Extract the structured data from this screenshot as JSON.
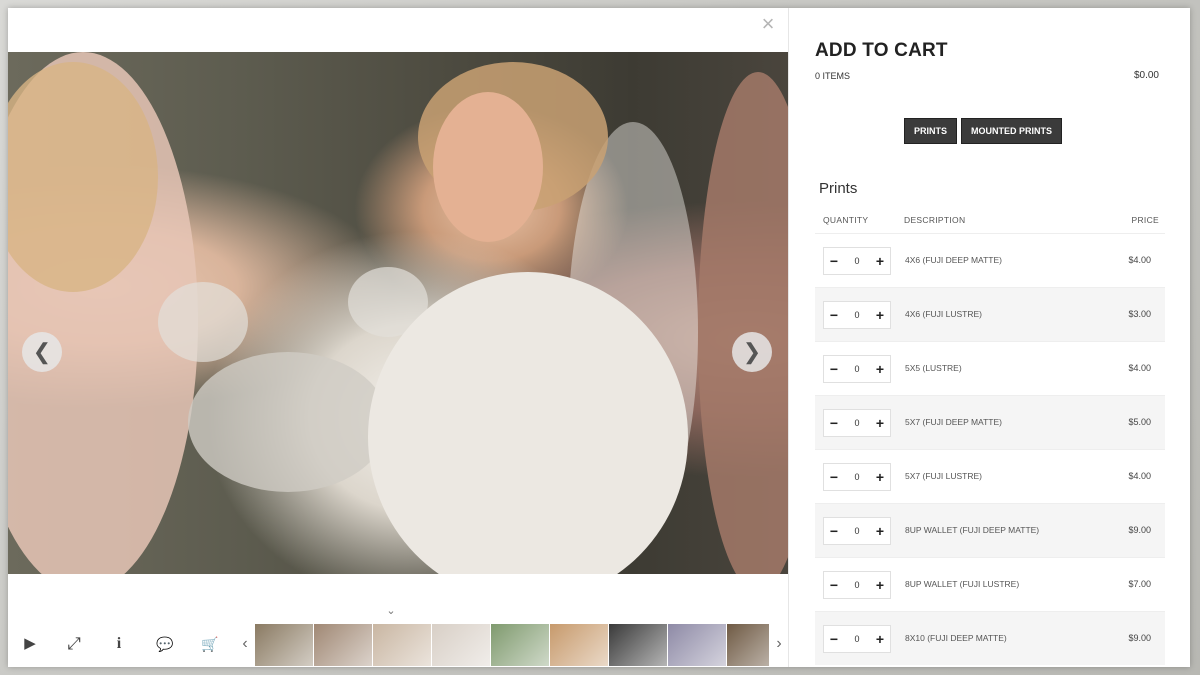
{
  "viewer": {
    "close_glyph": "×",
    "prev_glyph": "❮",
    "next_glyph": "❯",
    "collapse_glyph": "⌄",
    "toolbar": {
      "play_icon": "▶",
      "fullscreen_icon": "⤢",
      "info_icon": "i",
      "comment_icon": "💬",
      "cart_icon": "🛒"
    },
    "thumb_prev_glyph": "‹",
    "thumb_next_glyph": "›",
    "thumbnails": [
      {
        "color": "#8a7a62"
      },
      {
        "color": "#a08874"
      },
      {
        "color": "#c9b6a2"
      },
      {
        "color": "#d8cfc6"
      },
      {
        "color": "#7f9a6e"
      },
      {
        "color": "#c79a6c"
      },
      {
        "color": "#3a3a3a"
      },
      {
        "color": "#8e8aa6"
      },
      {
        "color": "#6f5a44"
      }
    ]
  },
  "cart": {
    "title": "ADD TO CART",
    "items_count": "0 ITEMS",
    "total": "$0.00",
    "tabs": [
      "PRINTS",
      "MOUNTED PRINTS"
    ],
    "section_title": "Prints",
    "columns": {
      "quantity": "QUANTITY",
      "description": "DESCRIPTION",
      "price": "PRICE"
    },
    "rows": [
      {
        "qty": "0",
        "desc": "4X6 (FUJI DEEP MATTE)",
        "price": "$4.00"
      },
      {
        "qty": "0",
        "desc": "4X6 (FUJI LUSTRE)",
        "price": "$3.00"
      },
      {
        "qty": "0",
        "desc": "5X5 (LUSTRE)",
        "price": "$4.00"
      },
      {
        "qty": "0",
        "desc": "5X7 (FUJI DEEP MATTE)",
        "price": "$5.00"
      },
      {
        "qty": "0",
        "desc": "5X7 (FUJI LUSTRE)",
        "price": "$4.00"
      },
      {
        "qty": "0",
        "desc": "8UP WALLET (FUJI DEEP MATTE)",
        "price": "$9.00"
      },
      {
        "qty": "0",
        "desc": "8UP WALLET (FUJI LUSTRE)",
        "price": "$7.00"
      },
      {
        "qty": "0",
        "desc": "8X10 (FUJI DEEP MATTE)",
        "price": "$9.00"
      }
    ],
    "stepper_minus": "−",
    "stepper_plus": "+"
  }
}
